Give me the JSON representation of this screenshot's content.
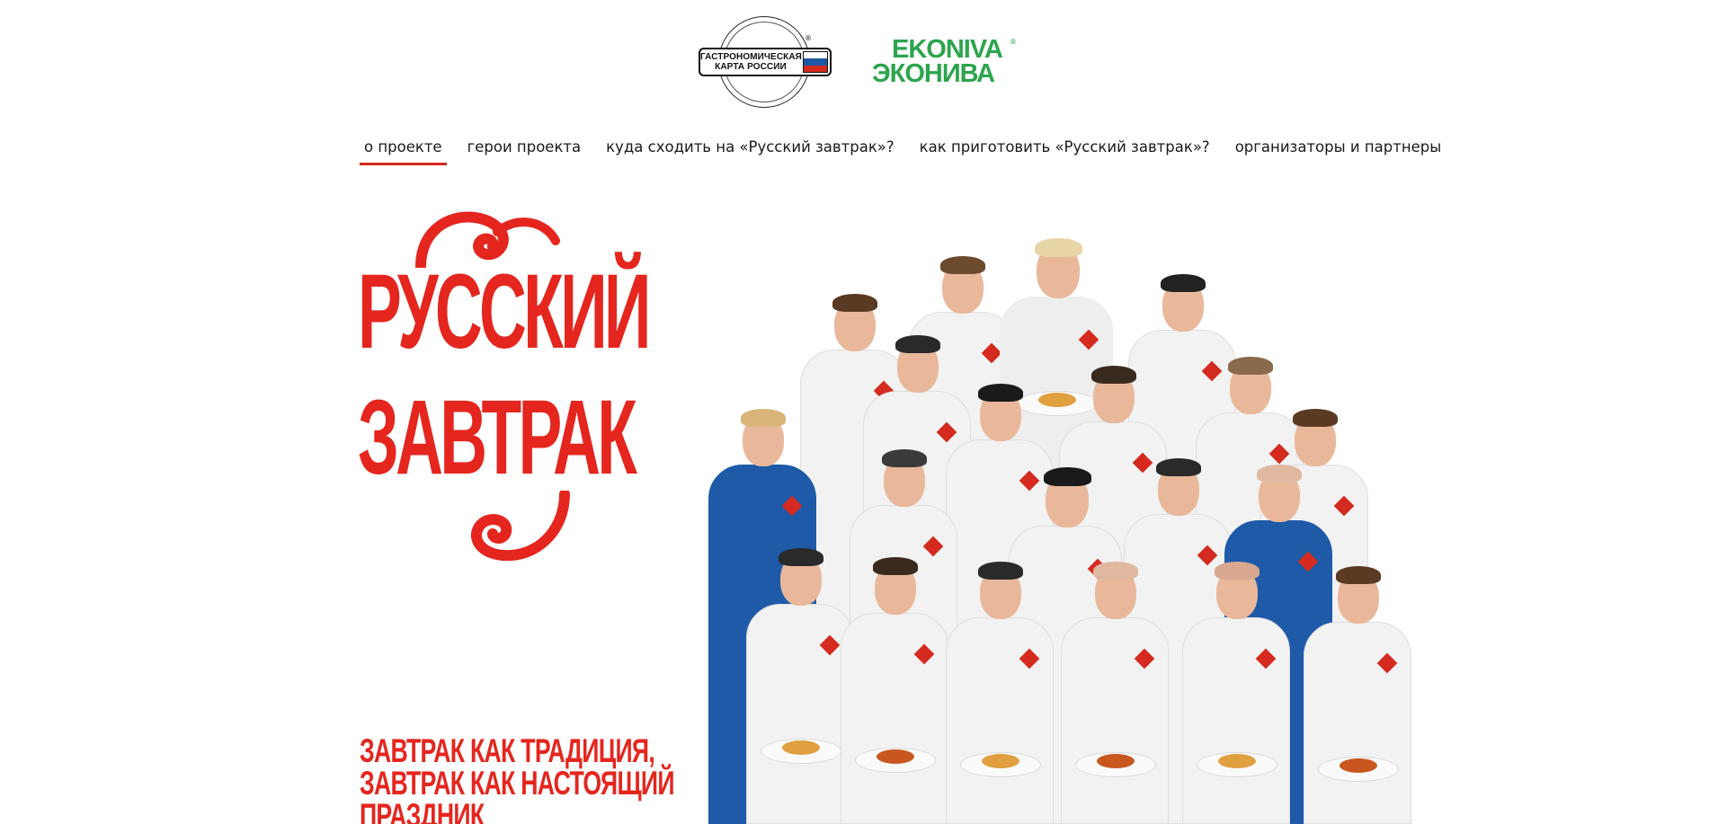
{
  "header": {
    "gastro_logo_text": "ГАСТРОНОМИЧЕСКАЯ КАРТА РОССИИ",
    "gastro_logo_line1": "ГАСТРОНОМИЧЕСКАЯ",
    "gastro_logo_line2": "КАРТА РОССИИ",
    "reg_mark": "®",
    "ekoniva_latin": "EKONIVA",
    "ekoniva_cyrillic": "ЭКОНИВА"
  },
  "nav": {
    "items": [
      {
        "label": "о проекте",
        "active": true
      },
      {
        "label": "герои проекта",
        "active": false
      },
      {
        "label": "куда сходить на «Русский завтрак»?",
        "active": false
      },
      {
        "label": "как приготовить «Русский завтрак»?",
        "active": false
      },
      {
        "label": "организаторы и партнеры",
        "active": false
      }
    ]
  },
  "hero": {
    "title_line1": "РУССКИЙ",
    "title_line2": "ЗАВТРАК",
    "tagline_line1": "ЗАВТРАК КАК ТРАДИЦИЯ,",
    "tagline_line2": "ЗАВТРАК КАК НАСТОЯЩИЙ",
    "tagline_line3": "ПРАЗДНИК"
  },
  "colors": {
    "brand_red": "#e4261f",
    "nav_underline": "#d42a1f",
    "ekoniva_green": "#2da44e",
    "flag_white": "#ffffff",
    "flag_blue": "#1c57a5",
    "flag_red": "#d52b1e"
  },
  "icons": {
    "gastro_logo": "gastronomic-map-logo-icon",
    "ekoniva_logo": "ekoniva-logo-icon",
    "flag": "russian-flag-icon"
  }
}
